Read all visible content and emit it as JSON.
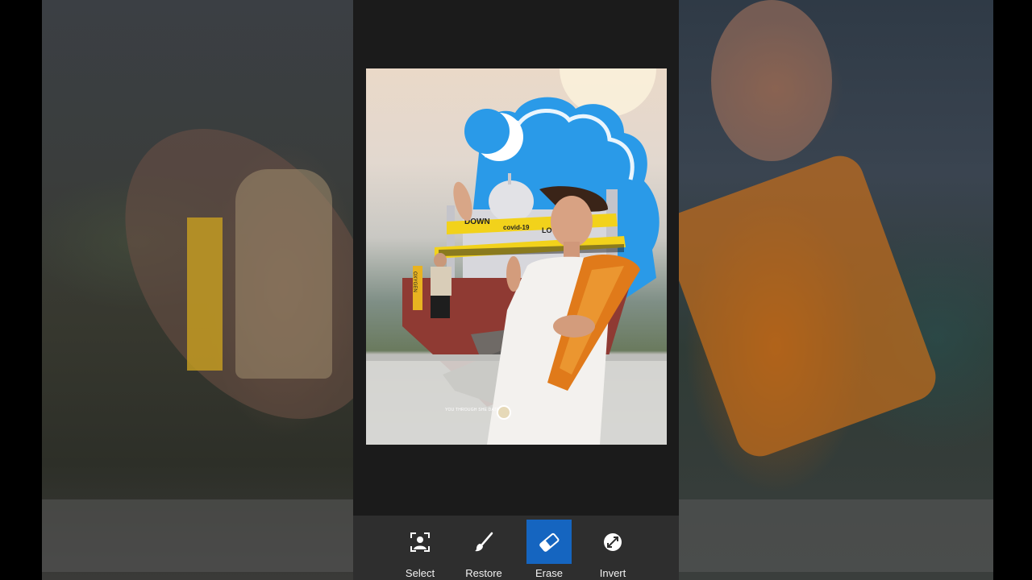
{
  "toolbar": {
    "tools": [
      {
        "label": "Select",
        "icon": "person-select-icon"
      },
      {
        "label": "Restore",
        "icon": "brush-icon"
      },
      {
        "label": "Erase",
        "icon": "eraser-icon",
        "active": true
      },
      {
        "label": "Invert",
        "icon": "invert-icon"
      }
    ]
  },
  "photo": {
    "tape_text_1": "DOWN",
    "tape_text_2": "covid-19",
    "tape_text_3": "LO",
    "poster_text": "OXYGEN",
    "small_caption": "YOU THROUGH SHE DATE AN"
  },
  "colors": {
    "panel": "#1b1b1b",
    "toolbar": "#2e2e2e",
    "active_tool": "#1565c0",
    "sky": "#2a9ae8",
    "scarf": "#e07a1a"
  }
}
